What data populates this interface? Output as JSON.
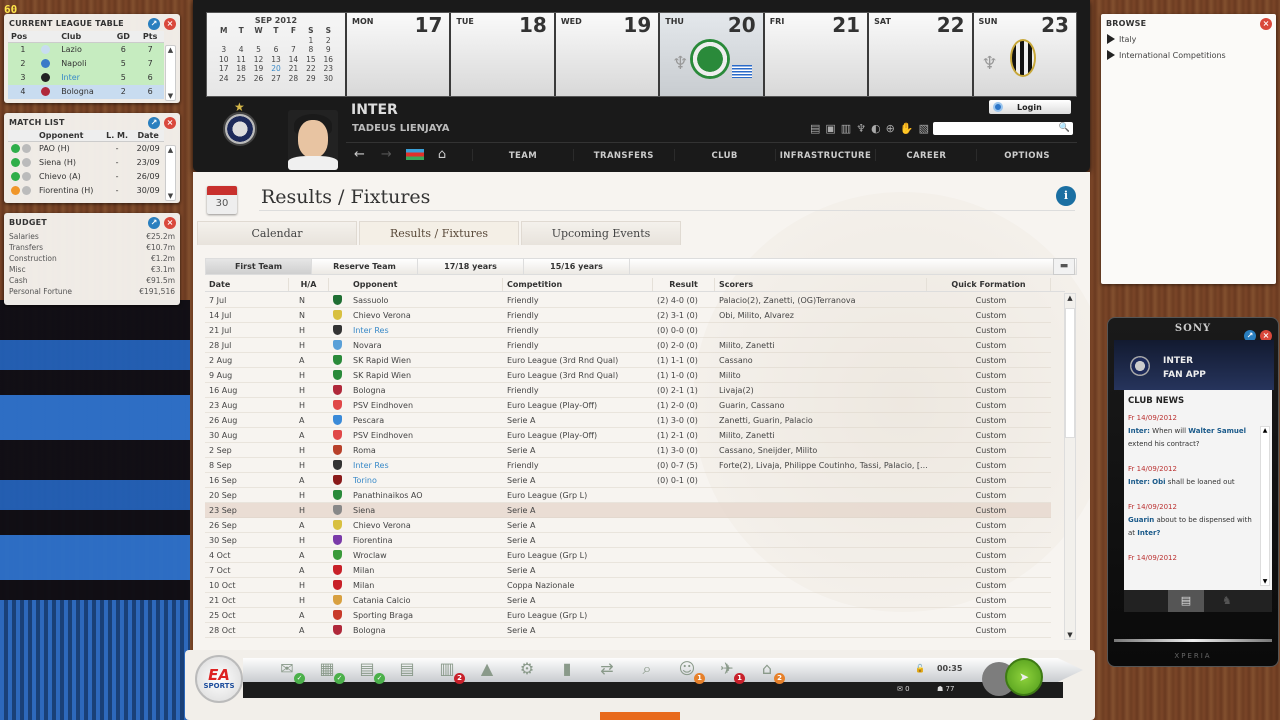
{
  "fps": "60",
  "league_table": {
    "title": "CURRENT LEAGUE TABLE",
    "columns": [
      "Pos",
      "Club",
      "GD",
      "Pts"
    ],
    "rows": [
      {
        "pos": "1",
        "club": "Lazio",
        "gd": "6",
        "pts": "7"
      },
      {
        "pos": "2",
        "club": "Napoli",
        "gd": "5",
        "pts": "7"
      },
      {
        "pos": "3",
        "club": "Inter",
        "gd": "5",
        "pts": "6"
      },
      {
        "pos": "4",
        "club": "Bologna",
        "gd": "2",
        "pts": "6"
      }
    ]
  },
  "match_list": {
    "title": "MATCH LIST",
    "columns": [
      "Opponent",
      "L. M.",
      "Date"
    ],
    "rows": [
      {
        "opponent": "PAO (H)",
        "lm": "-",
        "date": "20/09",
        "status": "#2fae4a"
      },
      {
        "opponent": "Siena (H)",
        "lm": "-",
        "date": "23/09",
        "status": "#2fae4a"
      },
      {
        "opponent": "Chievo (A)",
        "lm": "-",
        "date": "26/09",
        "status": "#2fae4a"
      },
      {
        "opponent": "Fiorentina (H)",
        "lm": "-",
        "date": "30/09",
        "status": "#f0962a"
      }
    ]
  },
  "budget": {
    "title": "BUDGET",
    "rows": [
      {
        "label": "Salaries",
        "value": "€25.2m"
      },
      {
        "label": "Transfers",
        "value": "€10.7m"
      },
      {
        "label": "Construction",
        "value": "€1.2m"
      },
      {
        "label": "Misc",
        "value": "€3.1m"
      },
      {
        "label": "Cash",
        "value": "€91.5m"
      },
      {
        "label": "Personal Fortune",
        "value": "€191,516"
      }
    ]
  },
  "calendar": {
    "month": "SEP 2012",
    "weekday_headers": [
      "M",
      "T",
      "W",
      "T",
      "F",
      "S",
      "S"
    ],
    "weeks": [
      [
        "",
        "",
        "",
        "",
        "",
        "1",
        "2"
      ],
      [
        "3",
        "4",
        "5",
        "6",
        "7",
        "8",
        "9"
      ],
      [
        "10",
        "11",
        "12",
        "13",
        "14",
        "15",
        "16"
      ],
      [
        "17",
        "18",
        "19",
        "20",
        "21",
        "22",
        "23"
      ],
      [
        "24",
        "25",
        "26",
        "27",
        "28",
        "29",
        "30"
      ]
    ],
    "selected_day": "20",
    "days": [
      {
        "name": "MON",
        "num": "17"
      },
      {
        "name": "TUE",
        "num": "18"
      },
      {
        "name": "WED",
        "num": "19"
      },
      {
        "name": "THU",
        "num": "20"
      },
      {
        "name": "FRI",
        "num": "21"
      },
      {
        "name": "SAT",
        "num": "22"
      },
      {
        "name": "SUN",
        "num": "23"
      }
    ]
  },
  "header": {
    "club": "INTER",
    "manager": "TADEUS LIENJAYA",
    "login_label": "Login",
    "search_value": "",
    "menu": [
      "TEAM",
      "TRANSFERS",
      "CLUB",
      "INFRASTRUCTURE",
      "CAREER",
      "OPTIONS"
    ]
  },
  "page": {
    "icon_num": "30",
    "title": "Results / Fixtures",
    "tabs": [
      "Calendar",
      "Results / Fixtures",
      "Upcoming Events"
    ],
    "subtabs": [
      "First Team",
      "Reserve Team",
      "17/18 years",
      "15/16 years"
    ],
    "columns": [
      "Date",
      "H/A",
      "Opponent",
      "Competition",
      "Result",
      "Scorers",
      "Quick Formation"
    ]
  },
  "fixtures": [
    {
      "date": "7 Jul",
      "ha": "N",
      "opp": "Sassuolo",
      "comp": "Friendly",
      "res": "(2) 4-0 (0)",
      "sc": "Palacio(2), Zanetti, (OG)Terranova",
      "qf": "Custom",
      "crest": "#1f6e33"
    },
    {
      "date": "14 Jul",
      "ha": "N",
      "opp": "Chievo Verona",
      "comp": "Friendly",
      "res": "(2) 3-1 (0)",
      "sc": "Obi, Milito, Alvarez",
      "qf": "Custom",
      "crest": "#d8c040"
    },
    {
      "date": "21 Jul",
      "ha": "H",
      "opp": "Inter Res",
      "comp": "Friendly",
      "res": "(0) 0-0 (0)",
      "sc": "",
      "qf": "Custom",
      "crest": "#333",
      "link": true
    },
    {
      "date": "28 Jul",
      "ha": "H",
      "opp": "Novara",
      "comp": "Friendly",
      "res": "(0) 2-0 (0)",
      "sc": "Milito, Zanetti",
      "qf": "Custom",
      "crest": "#5aa0d8"
    },
    {
      "date": "2 Aug",
      "ha": "A",
      "opp": "SK Rapid Wien",
      "comp": "Euro League (3rd Rnd Qual)",
      "res": "(1) 1-1 (0)",
      "sc": "Cassano",
      "qf": "Custom",
      "crest": "#2a8a3a"
    },
    {
      "date": "9 Aug",
      "ha": "H",
      "opp": "SK Rapid Wien",
      "comp": "Euro League (3rd Rnd Qual)",
      "res": "(1) 1-0 (0)",
      "sc": "Milito",
      "qf": "Custom",
      "crest": "#2a8a3a"
    },
    {
      "date": "16 Aug",
      "ha": "H",
      "opp": "Bologna",
      "comp": "Friendly",
      "res": "(0) 2-1 (1)",
      "sc": "Livaja(2)",
      "qf": "Custom",
      "crest": "#b0283a"
    },
    {
      "date": "23 Aug",
      "ha": "H",
      "opp": "PSV Eindhoven",
      "comp": "Euro League (Play-Off)",
      "res": "(1) 2-0 (0)",
      "sc": "Guarin, Cassano",
      "qf": "Custom",
      "crest": "#e04848"
    },
    {
      "date": "26 Aug",
      "ha": "A",
      "opp": "Pescara",
      "comp": "Serie A",
      "res": "(1) 3-0 (0)",
      "sc": "Zanetti, Guarin, Palacio",
      "qf": "Custom",
      "crest": "#3a8ad8"
    },
    {
      "date": "30 Aug",
      "ha": "A",
      "opp": "PSV Eindhoven",
      "comp": "Euro League (Play-Off)",
      "res": "(1) 2-1 (0)",
      "sc": "Milito, Zanetti",
      "qf": "Custom",
      "crest": "#e04848"
    },
    {
      "date": "2 Sep",
      "ha": "H",
      "opp": "Roma",
      "comp": "Serie A",
      "res": "(1) 3-0 (0)",
      "sc": "Cassano, Sneijder, Milito",
      "qf": "Custom",
      "crest": "#b8402a"
    },
    {
      "date": "8 Sep",
      "ha": "H",
      "opp": "Inter Res",
      "comp": "Friendly",
      "res": "(0) 0-7 (5)",
      "sc": "Forte(2), Livaja, Philippe Coutinho, Tassi, Palacio, [...]",
      "qf": "Custom",
      "crest": "#333",
      "link": true
    },
    {
      "date": "16 Sep",
      "ha": "A",
      "opp": "Torino",
      "comp": "Serie A",
      "res": "(0) 0-1 (0)",
      "sc": "",
      "qf": "Custom",
      "crest": "#8a1a1a",
      "link": true
    },
    {
      "date": "20 Sep",
      "ha": "H",
      "opp": "Panathinaikos AO",
      "comp": "Euro League (Grp L)",
      "res": "",
      "sc": "",
      "qf": "Custom",
      "crest": "#2a8a3a"
    },
    {
      "date": "23 Sep",
      "ha": "H",
      "opp": "Siena",
      "comp": "Serie A",
      "res": "",
      "sc": "",
      "qf": "Custom",
      "crest": "#888",
      "highlight": true
    },
    {
      "date": "26 Sep",
      "ha": "A",
      "opp": "Chievo Verona",
      "comp": "Serie A",
      "res": "",
      "sc": "",
      "qf": "Custom",
      "crest": "#d8c040"
    },
    {
      "date": "30 Sep",
      "ha": "H",
      "opp": "Fiorentina",
      "comp": "Serie A",
      "res": "",
      "sc": "",
      "qf": "Custom",
      "crest": "#7a3aa8"
    },
    {
      "date": "4 Oct",
      "ha": "A",
      "opp": "Wroclaw",
      "comp": "Euro League (Grp L)",
      "res": "",
      "sc": "",
      "qf": "Custom",
      "crest": "#3a9a3a"
    },
    {
      "date": "7 Oct",
      "ha": "A",
      "opp": "Milan",
      "comp": "Serie A",
      "res": "",
      "sc": "",
      "qf": "Custom",
      "crest": "#c82028"
    },
    {
      "date": "10 Oct",
      "ha": "H",
      "opp": "Milan",
      "comp": "Coppa Nazionale",
      "res": "",
      "sc": "",
      "qf": "Custom",
      "crest": "#c82028"
    },
    {
      "date": "21 Oct",
      "ha": "H",
      "opp": "Catania Calcio",
      "comp": "Serie A",
      "res": "",
      "sc": "",
      "qf": "Custom",
      "crest": "#d8a040"
    },
    {
      "date": "25 Oct",
      "ha": "A",
      "opp": "Sporting Braga",
      "comp": "Euro League (Grp L)",
      "res": "",
      "sc": "",
      "qf": "Custom",
      "crest": "#c83a2a"
    },
    {
      "date": "28 Oct",
      "ha": "A",
      "opp": "Bologna",
      "comp": "Serie A",
      "res": "",
      "sc": "",
      "qf": "Custom",
      "crest": "#b0283a"
    }
  ],
  "browse": {
    "title": "BROWSE",
    "items": [
      "Italy",
      "International Competitions"
    ]
  },
  "fan_app": {
    "brand": "SONY",
    "title_line1": "INTER",
    "title_line2": "FAN APP",
    "news_title": "CLUB NEWS",
    "news": [
      {
        "date": "Fr 14/09/2012",
        "parts": [
          [
            "b",
            "Inter:"
          ],
          [
            "t",
            " When will "
          ],
          [
            "b",
            "Walter Samuel"
          ],
          [
            "t",
            " extend his contract?"
          ]
        ]
      },
      {
        "date": "Fr 14/09/2012",
        "parts": [
          [
            "b",
            "Inter:"
          ],
          [
            "t",
            " "
          ],
          [
            "b",
            "Obi"
          ],
          [
            "t",
            " shall be loaned out"
          ]
        ]
      },
      {
        "date": "Fr 14/09/2012",
        "parts": [
          [
            "b",
            "Guarin"
          ],
          [
            "t",
            " about to be dispensed with at "
          ],
          [
            "b",
            "Inter?"
          ]
        ]
      },
      {
        "date": "Fr 14/09/2012",
        "parts": []
      }
    ],
    "footer": "XPERIA"
  },
  "toolbar": {
    "logo_line1": "EA",
    "logo_line2": "SPORTS",
    "icons": [
      {
        "name": "mail-icon",
        "glyph": "✉",
        "badge": "✓",
        "badge_color": "green"
      },
      {
        "name": "calendar-icon",
        "glyph": "▦",
        "badge": "✓",
        "badge_color": "green"
      },
      {
        "name": "tactics-icon",
        "glyph": "▤",
        "badge": "✓",
        "badge_color": "green"
      },
      {
        "name": "tactics-2-icon",
        "glyph": "▤",
        "badge": "",
        "badge_color": ""
      },
      {
        "name": "lineup-icon",
        "glyph": "▥",
        "badge": "2",
        "badge_color": "red"
      },
      {
        "name": "training-cone-icon",
        "glyph": "▲",
        "badge": "",
        "badge_color": ""
      },
      {
        "name": "youth-icon",
        "glyph": "⚙",
        "badge": "",
        "badge_color": ""
      },
      {
        "name": "documents-icon",
        "glyph": "▮",
        "badge": "",
        "badge_color": ""
      },
      {
        "name": "transfer-icon",
        "glyph": "⇄",
        "badge": "",
        "badge_color": ""
      },
      {
        "name": "scouting-icon",
        "glyph": "⌕",
        "badge": "",
        "badge_color": ""
      },
      {
        "name": "staff-icon",
        "glyph": "☺",
        "badge": "1",
        "badge_color": "orange"
      },
      {
        "name": "finance-icon",
        "glyph": "✈",
        "badge": "1",
        "badge_color": "red"
      },
      {
        "name": "stadium-icon",
        "glyph": "⌂",
        "badge": "2",
        "badge_color": "orange"
      }
    ],
    "clock": "00:35",
    "mail_count": "0",
    "fans_count": "77"
  }
}
